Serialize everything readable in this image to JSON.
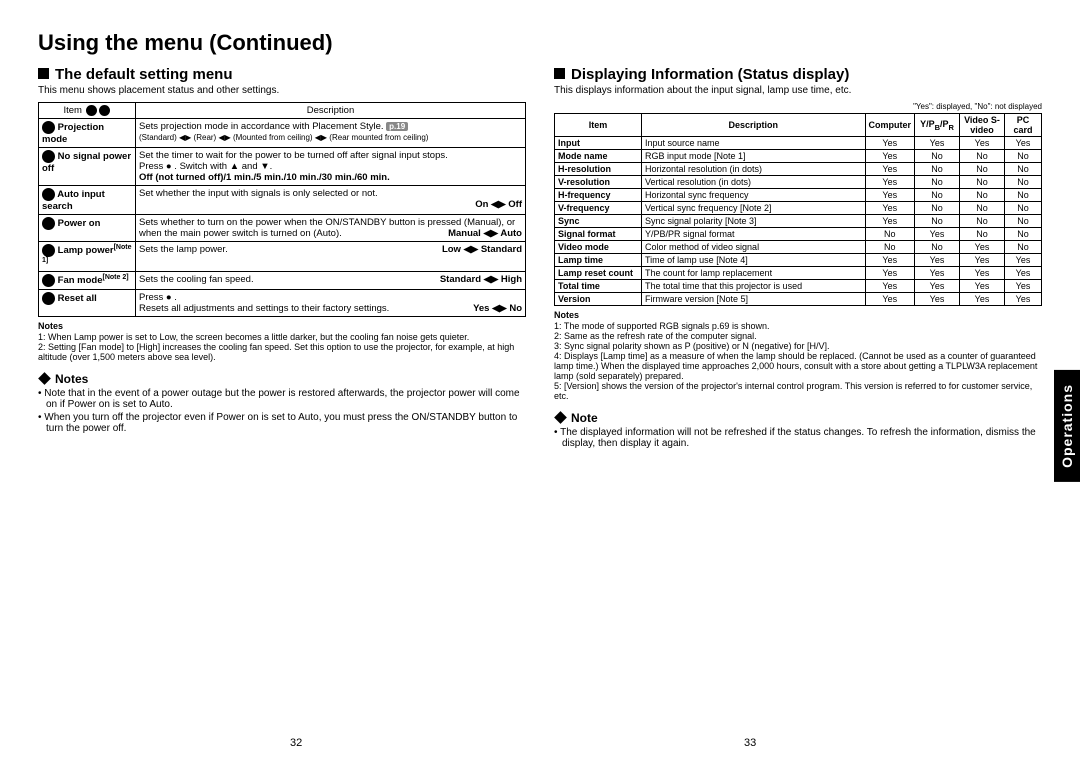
{
  "title": "Using the menu (Continued)",
  "left": {
    "heading": "The default setting menu",
    "sub": "This menu shows placement status and other settings.",
    "th_item": "Item",
    "th_desc": "Description",
    "rows": [
      {
        "item": "Projection mode",
        "desc": "Sets projection mode in accordance with Placement Style.",
        "extra": "(Standard) ◀▶ (Rear) ◀▶ (Mounted from ceiling) ◀▶ (Rear mounted from ceiling)",
        "pill": "p.19"
      },
      {
        "item": "No signal power off",
        "desc": "Set the timer to wait for the power to be turned off after signal input stops.",
        "extra": "Press ● . Switch with ▲ and ▼.",
        "extra2": "Off (not turned off)/1 min./5 min./10 min./30 min./60 min."
      },
      {
        "item": "Auto input search",
        "desc": "Set whether the input with signals is only selected or not.",
        "right": "On ◀▶ Off"
      },
      {
        "item": "Power on",
        "desc": "Sets whether to turn on the power when the ON/STANDBY button is pressed (Manual), or when the main power switch is turned on (Auto).",
        "right": "Manual ◀▶ Auto"
      },
      {
        "item": "Lamp power",
        "note": "[Note 1]",
        "desc": "Sets the lamp power.",
        "right": "Low ◀▶ Standard"
      },
      {
        "item": "Fan mode",
        "note": "[Note 2]",
        "desc": "Sets the cooling fan speed.",
        "right": "Standard ◀▶ High"
      },
      {
        "item": "Reset all",
        "desc": "Press ● .",
        "extra": "Resets all adjustments and settings to their factory settings.",
        "right": "Yes ◀▶ No"
      }
    ],
    "notes_h": "Notes",
    "notes": [
      "1: When Lamp power is set to Low, the screen becomes a little darker, but the cooling fan noise gets quieter.",
      "2: Setting [Fan mode] to [High] increases the cooling fan speed. Set this option to use the projector, for example, at high altitude (over 1,500 meters above sea level)."
    ],
    "notes2_h": "Notes",
    "bullets": [
      "Note that in the event of a power outage but the power is restored afterwards, the projector power will come on if Power on is set to Auto.",
      "When you turn off the projector even if Power on is set to Auto, you must press the ON/STANDBY button to turn the power off."
    ],
    "page": "32"
  },
  "right": {
    "heading": "Displaying Information (Status display)",
    "sub": "This displays information about the input signal, lamp use time, etc.",
    "legend": "\"Yes\": displayed, \"No\": not displayed",
    "cols": [
      "Item",
      "Description",
      "Computer",
      "Y/PB/PR",
      "Video S-video",
      "PC card"
    ],
    "rows": [
      [
        "Input",
        "Input source name",
        "Yes",
        "Yes",
        "Yes",
        "Yes"
      ],
      [
        "Mode name",
        "RGB input mode [Note 1]",
        "Yes",
        "No",
        "No",
        "No"
      ],
      [
        "H-resolution",
        "Horizontal resolution (in dots)",
        "Yes",
        "No",
        "No",
        "No"
      ],
      [
        "V-resolution",
        "Vertical resolution (in dots)",
        "Yes",
        "No",
        "No",
        "No"
      ],
      [
        "H-frequency",
        "Horizontal sync frequency",
        "Yes",
        "No",
        "No",
        "No"
      ],
      [
        "V-frequency",
        "Vertical sync frequency [Note 2]",
        "Yes",
        "No",
        "No",
        "No"
      ],
      [
        "Sync",
        "Sync signal polarity [Note 3]",
        "Yes",
        "No",
        "No",
        "No"
      ],
      [
        "Signal format",
        "Y/PB/PR signal format",
        "No",
        "Yes",
        "No",
        "No"
      ],
      [
        "Video mode",
        "Color method of video signal",
        "No",
        "No",
        "Yes",
        "No"
      ],
      [
        "Lamp time",
        "Time of lamp use [Note 4]",
        "Yes",
        "Yes",
        "Yes",
        "Yes"
      ],
      [
        "Lamp reset count",
        "The count for lamp replacement",
        "Yes",
        "Yes",
        "Yes",
        "Yes"
      ],
      [
        "Total time",
        "The total time that this projector is used",
        "Yes",
        "Yes",
        "Yes",
        "Yes"
      ],
      [
        "Version",
        "Firmware version [Note 5]",
        "Yes",
        "Yes",
        "Yes",
        "Yes"
      ]
    ],
    "notes_h": "Notes",
    "notes": [
      "1: The mode of supported RGB signals p.69 is shown.",
      "2: Same as the refresh rate of the computer signal.",
      "3: Sync signal polarity shown as P (positive) or N (negative) for [H/V].",
      "4: Displays [Lamp time] as a measure of when the lamp should be replaced. (Cannot be used as a counter of guaranteed lamp time.) When the displayed time approaches 2,000 hours, consult with a store about getting a TLPLW3A replacement lamp (sold separately) prepared.",
      "5: [Version] shows the version of the projector's internal control program. This version is referred to for customer service, etc."
    ],
    "note_h": "Note",
    "bullet": "The displayed information will not be refreshed if the status changes. To refresh the information, dismiss the display, then display it again.",
    "page": "33"
  },
  "sidetab": "Operations"
}
